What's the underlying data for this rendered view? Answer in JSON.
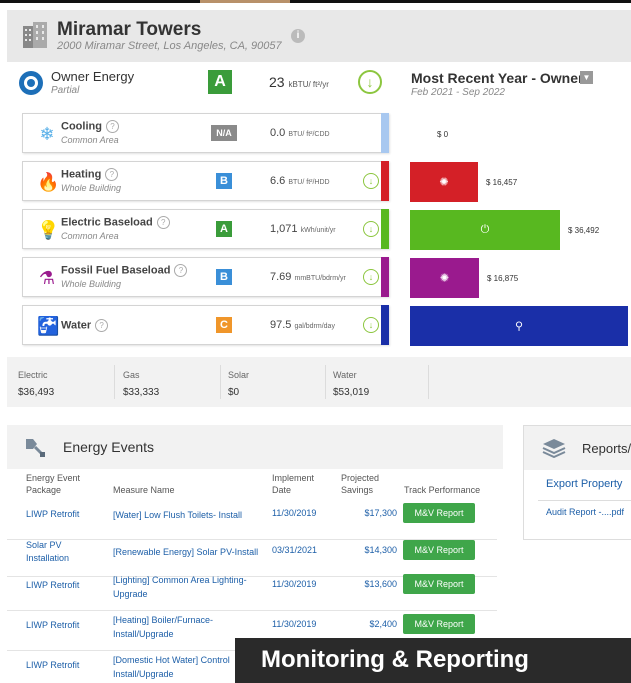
{
  "property": {
    "name": "Miramar Towers",
    "address": "2000 Miramar Street, Los Angeles, CA, 90057",
    "info_icon": "info-icon"
  },
  "owner": {
    "title": "Owner Energy",
    "subtitle": "Partial",
    "grade": "A",
    "value": "23",
    "unit": "kBTU/ ft²/yr",
    "trend": "down-arrow-icon"
  },
  "recent": {
    "title": "Most Recent Year - Owner",
    "range": "Feb 2021 - Sep 2022"
  },
  "categories": [
    {
      "name": "Cooling",
      "sub": "Common Area",
      "grade": "N/A",
      "grade_color": "#8a8a8a",
      "value": "0.0",
      "unit": "BTU/ ft²/CDD",
      "stripe": "#a8c8f0",
      "bar_color": "#ffffff",
      "bar_value": 0,
      "bar_label": "$ 0",
      "icon": "snowflake-icon"
    },
    {
      "name": "Heating",
      "sub": "Whole Building",
      "grade": "B",
      "grade_color": "#3a8fd8",
      "value": "6.6",
      "unit": "BTU/ ft²/HDD",
      "stripe": "#d42027",
      "bar_color": "#d42027",
      "bar_value": 16457,
      "bar_label": "$ 16,457",
      "icon": "flame-icon"
    },
    {
      "name": "Electric Baseload",
      "sub": "Common Area",
      "grade": "A",
      "grade_color": "#3a9c3a",
      "value": "1,071",
      "unit": "kWh/unit/yr",
      "stripe": "#58b820",
      "bar_color": "#58b820",
      "bar_value": 36492,
      "bar_label": "$ 36,492",
      "icon": "bulb-icon"
    },
    {
      "name": "Fossil Fuel Baseload",
      "sub": "Whole Building",
      "grade": "B",
      "grade_color": "#3a8fd8",
      "value": "7.69",
      "unit": "mmBTU/bdrm/yr",
      "stripe": "#9a1a8e",
      "bar_color": "#9a1a8e",
      "bar_value": 16875,
      "bar_label": "$ 16,875",
      "icon": "faucet-flame-icon"
    },
    {
      "name": "Water",
      "sub": "",
      "grade": "C",
      "grade_color": "#f0962a",
      "value": "97.5",
      "unit": "gal/bdrm/day",
      "stripe": "#1a2fa8",
      "bar_color": "#1a2fa8",
      "bar_value": 53019,
      "bar_label": "",
      "icon": "water-faucet-icon"
    }
  ],
  "totals": [
    {
      "label": "Electric",
      "value": "$36,493"
    },
    {
      "label": "Gas",
      "value": "$33,333"
    },
    {
      "label": "Solar",
      "value": "$0"
    },
    {
      "label": "Water",
      "value": "$53,019"
    }
  ],
  "events": {
    "title": "Energy Events",
    "headers": {
      "package": "Energy Event Package",
      "measure": "Measure Name",
      "date": "Implement Date",
      "savings": "Projected Savings",
      "track": "Track Performance"
    },
    "rows": [
      {
        "package": "LIWP Retrofit",
        "measure": "[Water] Low Flush Toilets- Install",
        "date": "11/30/2019",
        "savings": "$17,300",
        "button": "M&V Report"
      },
      {
        "package": "Solar PV Installation",
        "measure": "[Renewable Energy] Solar PV-Install",
        "date": "03/31/2021",
        "savings": "$14,300",
        "button": "M&V Report"
      },
      {
        "package": "LIWP Retrofit",
        "measure": "[Lighting] Common Area Lighting-Upgrade",
        "date": "11/30/2019",
        "savings": "$13,600",
        "button": "M&V Report"
      },
      {
        "package": "LIWP Retrofit",
        "measure": "[Heating] Boiler/Furnace-Install/Upgrade",
        "date": "11/30/2019",
        "savings": "$2,400",
        "button": "M&V Report"
      },
      {
        "package": "LIWP Retrofit",
        "measure": "[Domestic Hot Water] Control Install/Upgrade",
        "date": "",
        "savings": "",
        "button": ""
      }
    ]
  },
  "reports": {
    "title": "Reports/",
    "export": "Export Property",
    "audit": "Audit Report -....pdf"
  },
  "banner": "Monitoring & Reporting"
}
